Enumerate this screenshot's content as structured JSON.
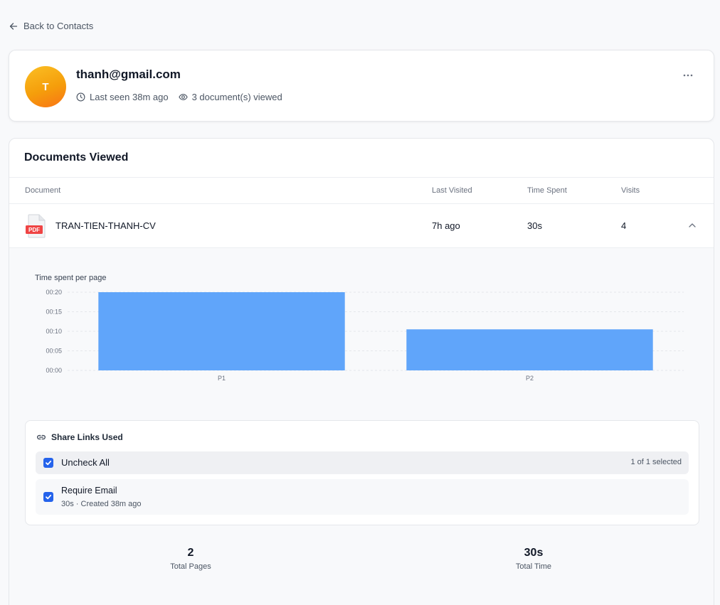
{
  "nav": {
    "back_label": "Back to Contacts"
  },
  "contact": {
    "avatar_initial": "T",
    "email": "thanh@gmail.com",
    "last_seen": "Last seen 38m ago",
    "docs_viewed": "3 document(s) viewed"
  },
  "documents": {
    "title": "Documents Viewed",
    "columns": {
      "document": "Document",
      "last_visited": "Last Visited",
      "time_spent": "Time Spent",
      "visits": "Visits"
    },
    "row": {
      "file_badge": "PDF",
      "name": "TRAN-TIEN-THANH-CV",
      "last_visited": "7h ago",
      "time_spent": "30s",
      "visits": "4"
    }
  },
  "chart_title": "Time spent per page",
  "chart_data": {
    "type": "bar",
    "title": "Time spent per page",
    "categories": [
      "P1",
      "P2"
    ],
    "values": [
      20,
      10.5
    ],
    "value_unit": "seconds",
    "y_ticks": [
      "00:00",
      "00:05",
      "00:10",
      "00:15",
      "00:20"
    ],
    "ylim": [
      0,
      20
    ],
    "grid": true,
    "bar_color": "#60a5fa"
  },
  "share_links": {
    "title": "Share Links Used",
    "uncheck_all_label": "Uncheck All",
    "selected_count": "1 of 1 selected",
    "links": [
      {
        "name": "Require Email",
        "meta": "30s · Created 38m ago",
        "checked": true
      }
    ]
  },
  "stats": {
    "total_pages_value": "2",
    "total_pages_label": "Total Pages",
    "total_time_value": "30s",
    "total_time_label": "Total Time"
  },
  "colors": {
    "accent": "#2563eb",
    "avatar_from": "#fbbf24",
    "avatar_to": "#f97316",
    "pdf_red": "#ef4444"
  }
}
